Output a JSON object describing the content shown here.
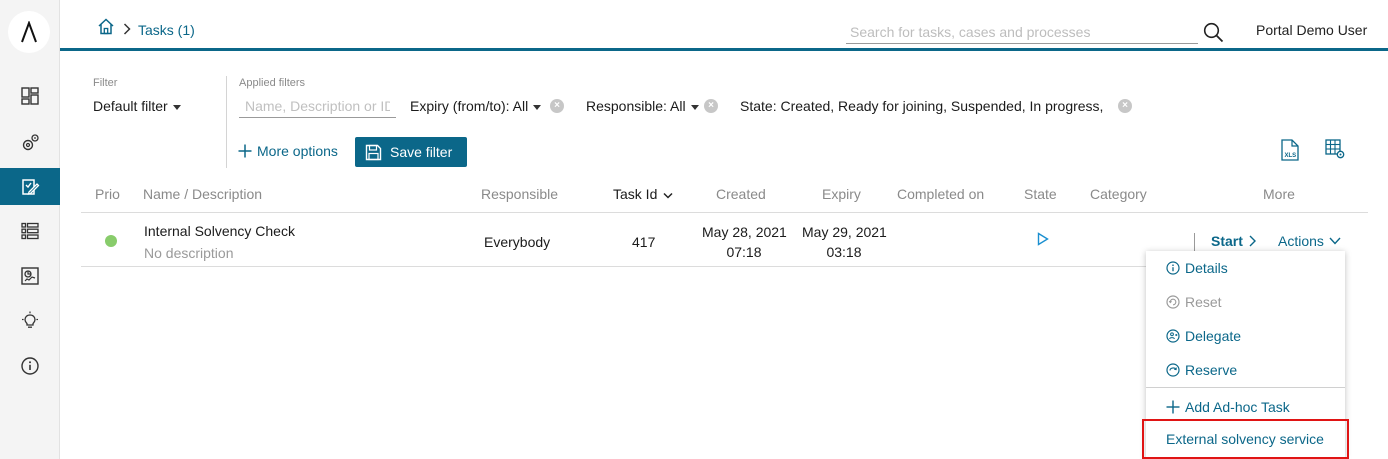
{
  "header": {
    "breadcrumb": "Tasks (1)",
    "search_placeholder": "Search for tasks, cases and processes",
    "user": "Portal Demo User"
  },
  "sidebar": {
    "items": [
      {
        "name": "dashboard",
        "active": false
      },
      {
        "name": "processes",
        "active": false
      },
      {
        "name": "tasks",
        "active": true
      },
      {
        "name": "cases",
        "active": false
      },
      {
        "name": "statistics",
        "active": false
      },
      {
        "name": "ideas",
        "active": false
      },
      {
        "name": "info",
        "active": false
      }
    ]
  },
  "filter": {
    "label": "Filter",
    "value": "Default filter",
    "applied_label": "Applied filters",
    "name_placeholder": "Name, Description or ID",
    "chips": [
      "Expiry (from/to): All",
      "Responsible: All",
      "State: Created, Ready for joining, Suspended, In progress,"
    ],
    "more_options": "More options",
    "save_filter": "Save filter"
  },
  "table": {
    "columns": [
      "Prio",
      "Name / Description",
      "Responsible",
      "Task Id",
      "Created",
      "Expiry",
      "Completed on",
      "State",
      "Category",
      "More"
    ],
    "rows": [
      {
        "name": "Internal Solvency Check",
        "description": "No description",
        "responsible": "Everybody",
        "task_id": "417",
        "created_date": "May 28, 2021",
        "created_time": "07:18",
        "expiry_date": "May 29, 2021",
        "expiry_time": "03:18",
        "start": "Start",
        "actions": "Actions"
      }
    ]
  },
  "actions_menu": {
    "items": [
      "Details",
      "Reset",
      "Delegate",
      "Reserve",
      "Add Ad-hoc Task",
      "External solvency service"
    ]
  },
  "colors": {
    "accent": "#0b6789",
    "prio_low": "#88cc6b",
    "highlight": "#e01414"
  }
}
